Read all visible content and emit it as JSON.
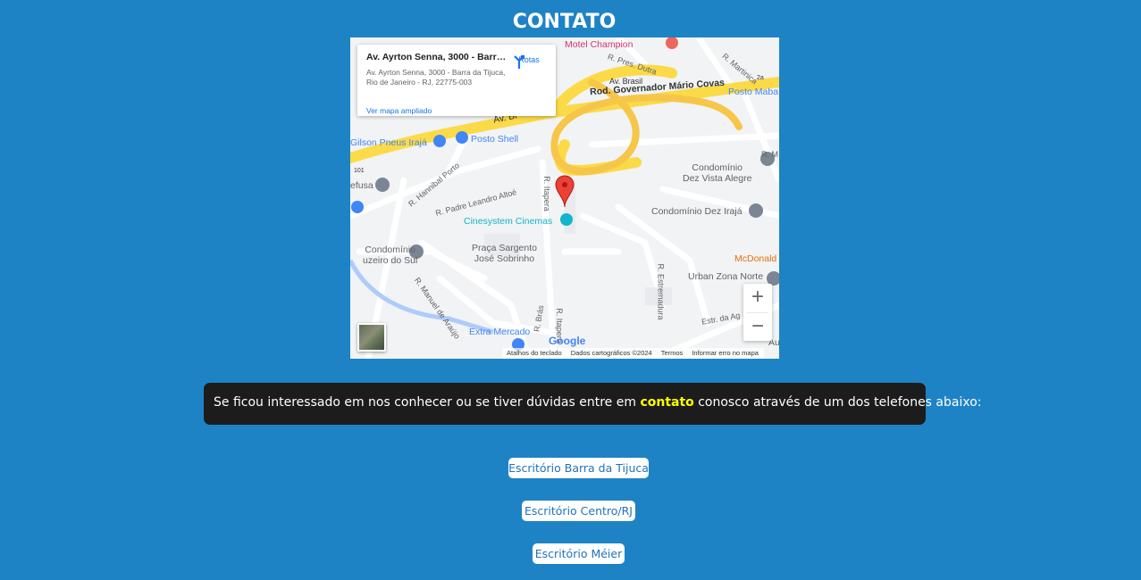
{
  "page_title": "CONTATO",
  "map": {
    "info_card": {
      "title": "Av. Ayrton Senna, 3000 - Barra da Tijuca",
      "address": "Av. Ayrton Senna, 3000 - Barra da Tijuca, Rio de Janeiro - RJ, 22775-003",
      "directions_label": "Rotas",
      "link": "Ver mapa ampliado"
    },
    "labels": {
      "motel": "Motel Champion",
      "rod_governador": "Rod. Governador Mário Covas",
      "av_brasil": "Av. Brasil",
      "av_brasil_short": "Av. Br",
      "r_pres_dutra": "R. Pres. Dutra",
      "r_martinica": "R. Martinica",
      "posto_maba": "Posto Maba",
      "gilson": "Gilson Pneus Irajá",
      "posto_shell": "Posto Shell",
      "hannibal": "R. Hannibal Porto",
      "padre": "R. Padre Leandro Altoé",
      "itapera": "R. Itapera",
      "itapera2": "R. Itapera",
      "cinesystem": "Cinesystem Cinemas",
      "cond_dez_vista": "Condomínio\nDez Vista Alegre",
      "cond_dez_iraja": "Condomínio Dez Irajá",
      "mcdonalds": "McDonald",
      "urban": "Urban Zona Norte",
      "cond_cruzeiro": "Condomínio\nuzeiro do Sul",
      "praca": "Praça Sargento\nJosé Sobrinho",
      "manuel": "R. Manuel de Araújo",
      "estremadura": "R. Estremadura",
      "extra": "Extra Mercado",
      "estr_ag": "Estr. da Ag",
      "efusa": "efusa",
      "au": "Au",
      "r_m": "R. M",
      "br_101": "101",
      "av_braz": "R. Brás",
      "two_a": "2a"
    },
    "footer": {
      "shortcuts": "Atalhos do teclado",
      "data": "Dados cartográficos ©2024",
      "terms": "Termos",
      "report": "Informar erro no mapa"
    },
    "zoom_in": "+",
    "zoom_out": "−",
    "logo": "Google"
  },
  "message": {
    "before": "Se ficou interessado em nos conhecer ou se tiver dúvidas entre em ",
    "highlight": "contato",
    "after": " conosco através de um dos telefones abaixo:"
  },
  "offices": [
    "Escritório Barra da Tijuca",
    "Escritório Centro/RJ",
    "Escritório Méier"
  ],
  "colors": {
    "background": "#1e83c5",
    "message_bg": "#1c1c1c",
    "highlight": "#ffff00",
    "link": "#1e73be"
  }
}
